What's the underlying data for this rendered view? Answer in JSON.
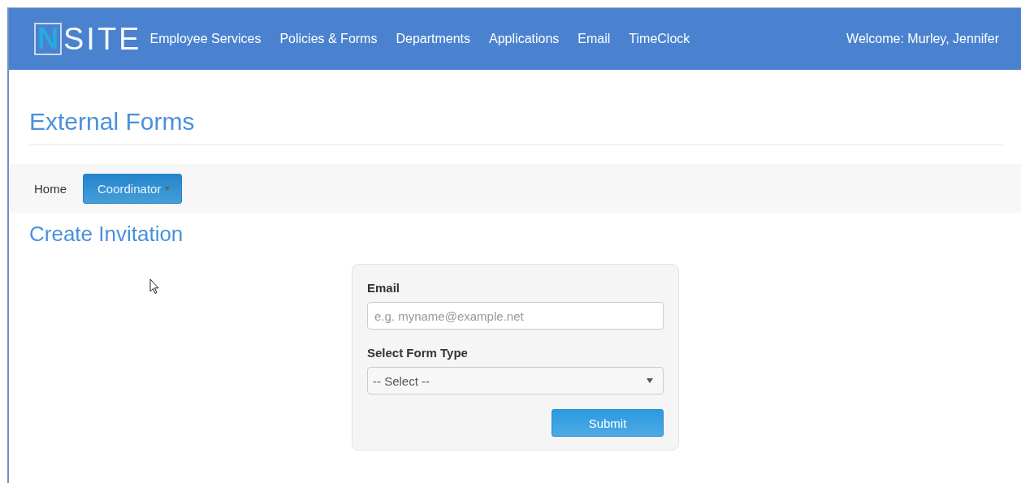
{
  "header": {
    "logo": {
      "boxed": "N",
      "rest": "SITE"
    },
    "nav": [
      {
        "label": "Employee Services"
      },
      {
        "label": "Policies & Forms"
      },
      {
        "label": "Departments"
      },
      {
        "label": "Applications"
      },
      {
        "label": "Email"
      },
      {
        "label": "TimeClock"
      }
    ],
    "welcome": "Welcome: Murley, Jennifer"
  },
  "page_title": "External Forms",
  "tabs": [
    {
      "label": "Home",
      "selected": false,
      "dropdown": false
    },
    {
      "label": "Coordinator",
      "selected": true,
      "dropdown": true
    }
  ],
  "section_title": "Create Invitation",
  "form": {
    "email": {
      "label": "Email",
      "placeholder": "e.g. myname@example.net"
    },
    "form_type": {
      "label": "Select Form Type",
      "value": "-- Select --"
    },
    "submit": "Submit"
  }
}
